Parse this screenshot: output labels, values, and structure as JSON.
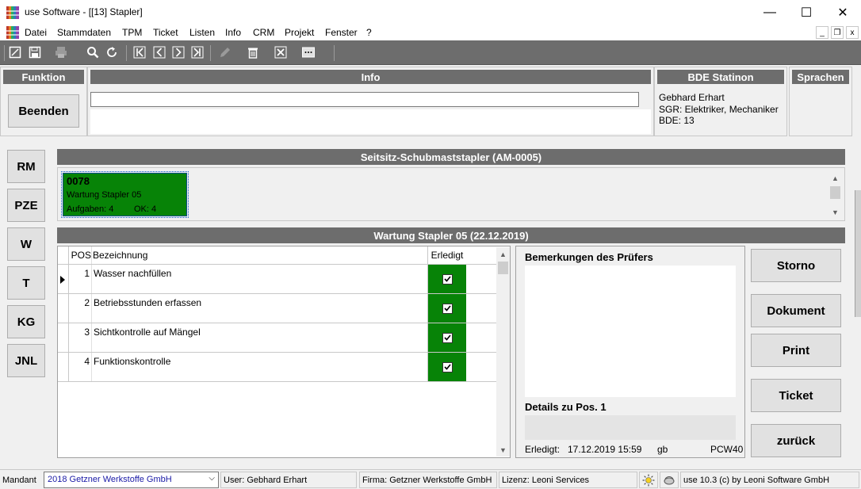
{
  "window": {
    "title": "use Software - [[13] Stapler]",
    "minimize": "—",
    "maximize": "☐",
    "close": "✕"
  },
  "menu": {
    "items": [
      "Datei",
      "Stammdaten",
      "TPM",
      "Ticket",
      "Listen",
      "Info",
      "CRM",
      "Projekt",
      "Fenster",
      "?"
    ],
    "mdi_min": "_",
    "mdi_restore": "❐",
    "mdi_close": "x"
  },
  "toolbar": {
    "icons": [
      "edit-icon",
      "save-icon",
      "print-icon",
      "search-icon",
      "refresh-icon",
      "first-record-icon",
      "previous-record-icon",
      "next-record-icon",
      "last-record-icon",
      "edit-disabled-icon",
      "delete-icon",
      "cancel-icon",
      "more-icon"
    ]
  },
  "panels": {
    "funktion": {
      "header": "Funktion",
      "button": "Beenden"
    },
    "info": {
      "header": "Info",
      "input_value": ""
    },
    "bde": {
      "header": "BDE Statinon",
      "lines": [
        "Gebhard Erhart",
        "SGR: Elektriker, Mechaniker",
        "BDE: 13"
      ]
    },
    "sprachen": {
      "header": "Sprachen"
    }
  },
  "side_buttons": [
    "RM",
    "PZE",
    "W",
    "T",
    "KG",
    "JNL"
  ],
  "machine": {
    "title": "Seitsitz-Schubmaststapler (AM-0005)",
    "card": {
      "number": "0078",
      "name": "Wartung Stapler 05",
      "tasks": "Aufgaben: 4",
      "ok": "OK: 4",
      "color": "#078307"
    }
  },
  "maintenance": {
    "title": "Wartung Stapler 05 (22.12.2019)",
    "columns": {
      "pos": "POS",
      "bezeichnung": "Bezeichnung",
      "erledigt": "Erledigt"
    },
    "rows": [
      {
        "pos": "1",
        "bezeichnung": "Wasser nachfüllen",
        "erledigt": true
      },
      {
        "pos": "2",
        "bezeichnung": "Betriebsstunden erfassen",
        "erledigt": true
      },
      {
        "pos": "3",
        "bezeichnung": "Sichtkontrolle auf Mängel",
        "erledigt": true
      },
      {
        "pos": "4",
        "bezeichnung": "Funktionskontrolle",
        "erledigt": true
      }
    ],
    "selected_row": 0
  },
  "remarks": {
    "header": "Bemerkungen des Prüfers",
    "text": "",
    "details_header": "Details zu Pos. 1",
    "details_text": "",
    "erledigt_label": "Erledigt:",
    "erledigt_date": "17.12.2019 15:59",
    "erledigt_user": "gb",
    "erledigt_pc": "PCW40"
  },
  "action_buttons": [
    "Storno",
    "Dokument",
    "Print",
    "Ticket",
    "zurück"
  ],
  "status": {
    "mandant_label": "Mandant",
    "mandant_value": "2018 Getzner Werkstoffe GmbH",
    "user": "User: Gebhard Erhart",
    "firma": "Firma: Getzner Werkstoffe GmbH",
    "lizenz": "Lizenz: Leoni Services",
    "version": "use 10.3 (c) by Leoni Software GmbH"
  },
  "colors": {
    "header_gray": "#6d6d6d",
    "check_green": "#078307",
    "mandant_text": "#1a1aa6"
  }
}
